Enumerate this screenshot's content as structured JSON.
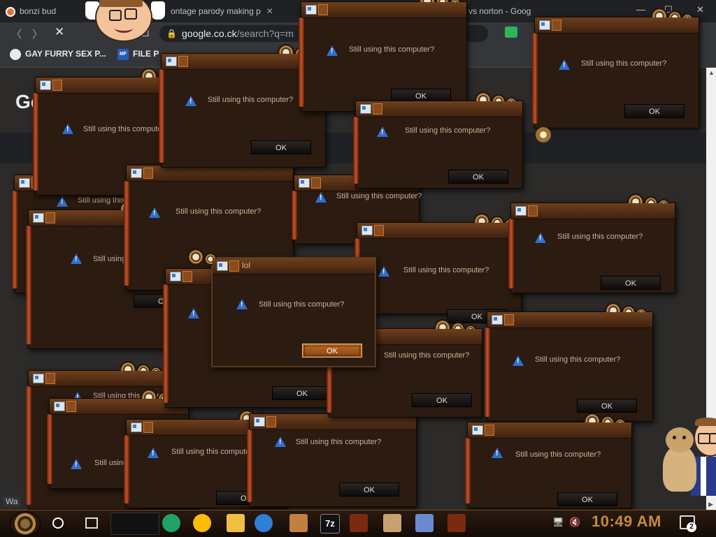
{
  "browser": {
    "tabs": [
      {
        "label": "bonzi bud",
        "favicon_color": "#e8703a"
      },
      {
        "label": "ontage parody making p",
        "favicon_color": "#4a90d9"
      },
      {
        "label": "",
        "favicon_color": "#4a90d9"
      },
      {
        "label": "e vs norton - Goog",
        "favicon_color": "#4285f4"
      }
    ],
    "tab_close": "✕",
    "url_domain": "google.co.ck",
    "url_rest": "/search?q=m",
    "bookmarks": [
      {
        "label": "GAY FURRY SEX P..."
      },
      {
        "label": "FILE P",
        "icon_text": "MF"
      }
    ],
    "google_logo_text": "Goog",
    "bottom_left_text": "Wa",
    "window_controls": {
      "minimize": "—",
      "maximize": "☐",
      "close": "✕"
    },
    "nav_icons": {
      "back": "back-arrow-icon",
      "forward": "forward-arrow-icon",
      "stop": "stop-x-icon",
      "bookmark": "bookmark-icon",
      "lock": "lock-icon"
    }
  },
  "dialogs": [
    {
      "message": "Still using this computer?",
      "ok_label": "OK"
    },
    {
      "message": "Still using this computer?",
      "ok_label": "OK"
    },
    {
      "message": "Still using this computer?",
      "ok_label": "OK"
    },
    {
      "message": "Still using this computer?",
      "ok_label": "OK"
    },
    {
      "message": "Still using this computer?",
      "ok_label": "OK"
    },
    {
      "message": "Still using this computer?",
      "ok_label": "OK"
    },
    {
      "message": "Still using this computer?",
      "ok_label": "OK"
    },
    {
      "message": "Still using this computer?",
      "ok_label": "OK"
    },
    {
      "message": "Still using this computer?",
      "ok_label": "OK"
    },
    {
      "message": "Still using this computer?",
      "ok_label": "OK"
    },
    {
      "message": "Still using this computer?",
      "ok_label": "OK"
    },
    {
      "message": "Still using this computer?",
      "ok_label": "OK"
    },
    {
      "message": "Still using this computer?",
      "ok_label": "OK"
    },
    {
      "message": "Still using this computer?",
      "ok_label": "OK"
    },
    {
      "message": "Still using this computer?",
      "ok_label": "OK"
    },
    {
      "message": "Still using this computer?",
      "ok_label": "OK"
    },
    {
      "message": "Still using this computer?",
      "ok_label": "OK"
    },
    {
      "message": "Still using this computer?",
      "ok_label": "OK"
    },
    {
      "message": "Still using this computer?",
      "ok_label": "OK"
    }
  ],
  "active_dialog": {
    "title": "lol",
    "message": "Still using this computer?",
    "ok_label": "OK"
  },
  "taskbar": {
    "clock": "10:49 AM",
    "notification_count": "2",
    "app_icons": [
      "sheets-icon",
      "chrome-icon",
      "file-explorer-icon",
      "edge-icon",
      "game-icon",
      "7zip-icon",
      "app-window-icon",
      "character-icon",
      "paint-icon",
      "app-window-icon"
    ],
    "seven_zip_label": "7z",
    "tray_icons": [
      "network-icon",
      "volume-muted-icon"
    ]
  },
  "colors": {
    "dialog_bg": "#2b1b10",
    "dialog_text": "#c9b49a",
    "ok_focused": "#b86a28",
    "clock": "#c58a3a",
    "chrome_dark": "#202124"
  }
}
